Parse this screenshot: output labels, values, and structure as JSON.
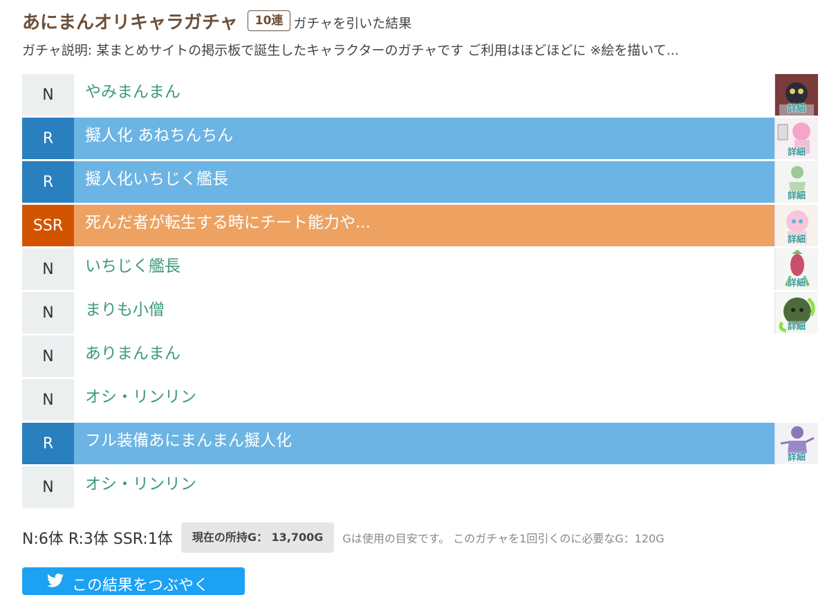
{
  "header": {
    "title": "あにまんオリキャラガチャ",
    "badge": "10連",
    "suffix": "ガチャを引いた結果",
    "description": "ガチャ説明: 某まとめサイトの掲示板で誕生したキャラクターのガチャです ご利用はほどほどに ※絵を描いて..."
  },
  "results": [
    {
      "rarity": "N",
      "name": "やみまんまん",
      "detail": "詳細",
      "thumb_icon": "dark-character-icon"
    },
    {
      "rarity": "R",
      "name": "擬人化 あねちんちん",
      "detail": "詳細",
      "thumb_icon": "pink-hair-character-icon"
    },
    {
      "rarity": "R",
      "name": "擬人化いちじく艦長",
      "detail": "詳細",
      "thumb_icon": "green-character-icon"
    },
    {
      "rarity": "SSR",
      "name": "死んだ者が転生する時にチート能力や...",
      "detail": "詳細",
      "thumb_icon": "pink-girl-character-icon"
    },
    {
      "rarity": "N",
      "name": "いちじく艦長",
      "detail": "詳細",
      "thumb_icon": "fig-character-icon"
    },
    {
      "rarity": "N",
      "name": "まりも小僧",
      "detail": "詳細",
      "thumb_icon": "marimo-character-icon"
    },
    {
      "rarity": "N",
      "name": "ありまんまん"
    },
    {
      "rarity": "N",
      "name": "オシ・リンリン"
    },
    {
      "rarity": "R",
      "name": "フル装備あにまんまん擬人化",
      "detail": "詳細",
      "thumb_icon": "purple-character-icon"
    },
    {
      "rarity": "N",
      "name": "オシ・リンリン"
    }
  ],
  "summary": {
    "counts": "N:6体 R:3体 SSR:1体",
    "gold": "現在の所持G： 13,700G",
    "note": "Gは使用の目安です。 このガチャを1回引くのに必要なG：120G"
  },
  "tweet_button": "この結果をつぶやく",
  "colors": {
    "N_rarity": "#eceff0",
    "N_text": "#3a9a7a",
    "R_rarity": "#2a7fbf",
    "R_row": "#6cb4e4",
    "SSR_rarity": "#d35400",
    "SSR_row": "#eda262",
    "twitter": "#1da1f2"
  }
}
